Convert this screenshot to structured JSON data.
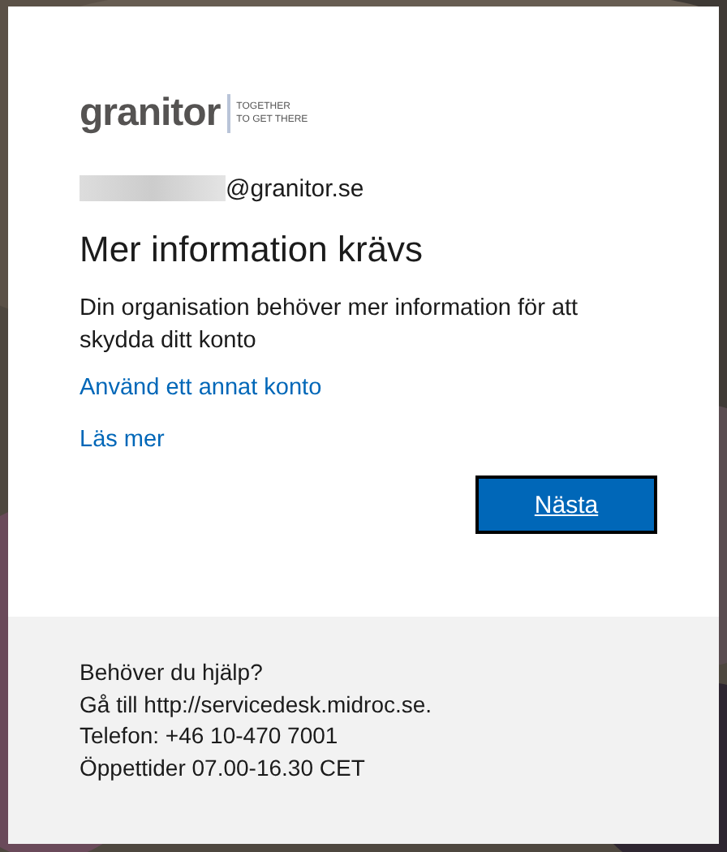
{
  "logo": {
    "wordmark": "granitor",
    "tagline": [
      "TOGETHER",
      "TO GET THERE"
    ]
  },
  "account": {
    "email_visible": "@granitor.se",
    "redacted": true
  },
  "title": "Mer information krävs",
  "message": "Din organisation behöver mer information för att skydda ditt konto",
  "links": [
    "Använd ett annat konto",
    "Läs mer"
  ],
  "buttons": [
    {
      "label": "Nästa",
      "focused": true
    }
  ],
  "footer": [
    "Behöver du hjälp?",
    "Gå till http://servicedesk.midroc.se.",
    "Telefon: +46 10-470 7001",
    "Öppettider 07.00-16.30 CET"
  ]
}
